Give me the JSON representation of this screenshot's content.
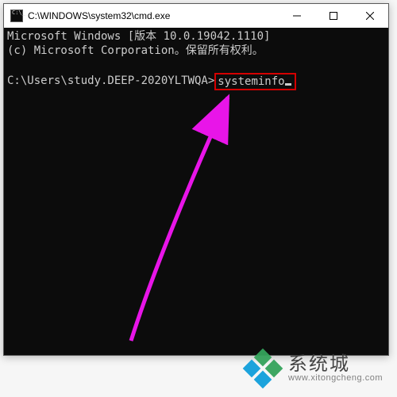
{
  "window": {
    "title": "C:\\WINDOWS\\system32\\cmd.exe",
    "controls": {
      "minimize": "minimize",
      "maximize": "maximize",
      "close": "close"
    }
  },
  "terminal": {
    "line1": "Microsoft Windows [版本 10.0.19042.1110]",
    "line2": "(c) Microsoft Corporation。保留所有权利。",
    "prompt": "C:\\Users\\study.DEEP-2020YLTWQA>",
    "command": "systeminfo"
  },
  "highlight": {
    "color": "#d40000",
    "target": "command-input"
  },
  "arrow": {
    "color": "#e815e8"
  },
  "watermark": {
    "brand_cn": "系统城",
    "brand_url": "www.xitongcheng.com",
    "logo_colors": [
      "#35a35c",
      "#119fdb"
    ]
  }
}
